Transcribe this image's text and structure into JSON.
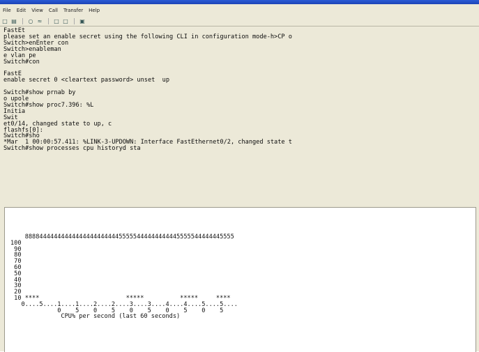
{
  "menu": {
    "items": [
      "File",
      "Edit",
      "View",
      "Call",
      "Transfer",
      "Help"
    ]
  },
  "toolbar": {
    "icons": [
      "new-icon",
      "open-icon",
      "disconnect-icon",
      "connect-icon",
      "send-icon",
      "receive-icon",
      "properties-icon"
    ]
  },
  "terminal": {
    "lines": [
      "FastEt",
      "please set an enable secret using the following CLI in configuration mode-h>CP o",
      "Switch>enEnter con",
      "Switch>enableman",
      "e vlan pe",
      "Switch#con",
      "",
      "FastE",
      "enable secret 0 <cleartext password> unset  up",
      "",
      "Switch#show prnab by",
      "o upole",
      "Switch#show proc7.396: %L",
      "Initia",
      "Swit",
      "et0/14, changed state to up, c",
      "flashfs[0]:",
      "Switch#sho",
      "*Mar  1 00:00:57.411: %LINK-3-UPDOWN: Interface FastEthernet0/2, changed state t",
      "Switch#show processes cpu historyd sta"
    ]
  },
  "cpu_history": {
    "lines": [
      "    8888444444444444444444444455555444444444445555544444445555",
      "100",
      " 90",
      " 80",
      " 70",
      " 60",
      " 50",
      " 40",
      " 30",
      " 20",
      " 10 ****                        *****          *****     ****",
      "   0....5....1....1....2....2....3....3....4....4....5....5....",
      "             0    5    0    5    0    5    0    5    0    5",
      "              CPU% per second (last 60 seconds)"
    ]
  }
}
